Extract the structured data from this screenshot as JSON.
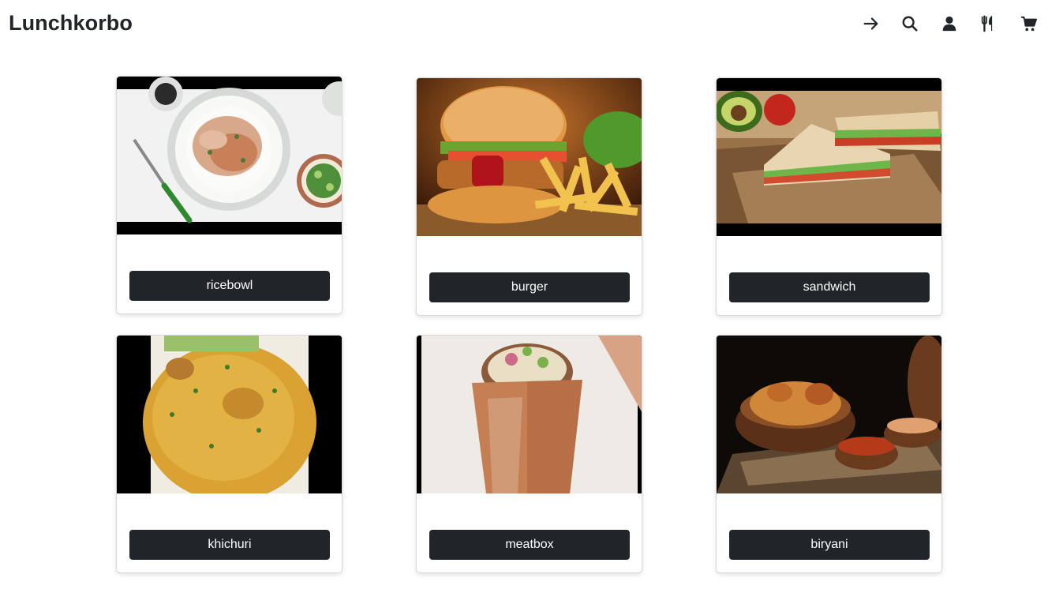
{
  "app": {
    "brand": "Lunchkorbo"
  },
  "nav": {
    "icons": [
      {
        "name": "sign-in-arrow-icon"
      },
      {
        "name": "search-icon"
      },
      {
        "name": "user-icon"
      },
      {
        "name": "utensils-icon"
      },
      {
        "name": "cart-icon"
      }
    ]
  },
  "menu": {
    "items": [
      {
        "label": "ricebowl",
        "image": "rice bowl with chicken"
      },
      {
        "label": "burger",
        "image": "burger with fries"
      },
      {
        "label": "sandwich",
        "image": "sandwich on board"
      },
      {
        "label": "khichuri",
        "image": "yellow khichuri"
      },
      {
        "label": "meatbox",
        "image": "meatbox in paper box"
      },
      {
        "label": "biryani",
        "image": "biryani in bowl"
      }
    ]
  },
  "colors": {
    "button_bg": "#212529",
    "text": "#212529"
  }
}
